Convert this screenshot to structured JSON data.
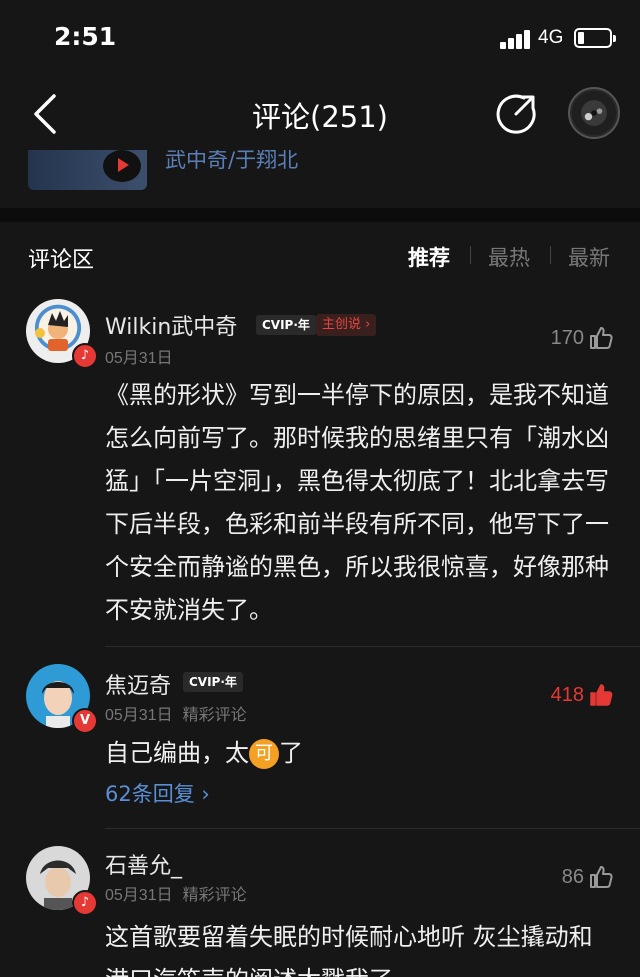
{
  "status_bar": {
    "time": "2:51",
    "network": "4G"
  },
  "nav": {
    "title": "评论(251)"
  },
  "song": {
    "artists": "武中奇/于翔北"
  },
  "section": {
    "title": "评论区",
    "sort_tabs": [
      "推荐",
      "最热",
      "最新"
    ]
  },
  "comments": [
    {
      "user": "Wilkin武中奇",
      "vip": "CVIP·年",
      "creator_badge": "主创说",
      "date": "05月31日",
      "likes": "170",
      "text": "《黑的形状》写到一半停下的原因，是我不知道怎么向前写了。那时候我的思绪里只有「潮水凶猛」「一片空洞」，黑色得太彻底了！北北拿去写下后半段，色彩和前半段有所不同，他写下了一个安全而静谧的黑色，所以我很惊喜，好像那种不安就消失了。"
    },
    {
      "user": "焦迈奇",
      "vip": "CVIP·年",
      "badge": "V",
      "date": "05月31日",
      "tag": "精彩评论",
      "likes": "418",
      "text_before": "自己编曲，太",
      "emoji": "可",
      "text_after": "了",
      "replies": "62条回复"
    },
    {
      "user": "石善允_",
      "date": "05月31日",
      "tag": "精彩评论",
      "likes": "86",
      "text": "这首歌要留着失眠的时候耐心地听 灰尘撬动和港口汽笛声的阐述太戳我了"
    }
  ],
  "colors": {
    "background": "#161616",
    "accent": "#e53935",
    "link": "#5a8fd6"
  }
}
